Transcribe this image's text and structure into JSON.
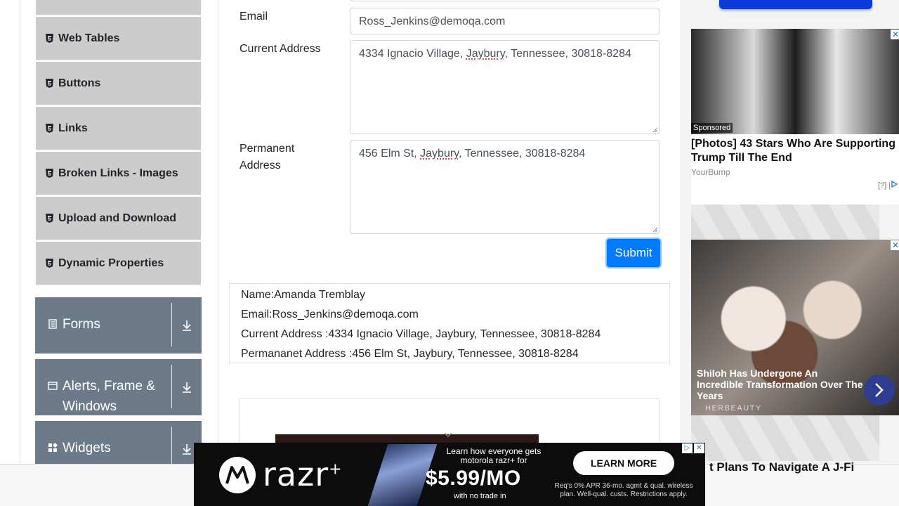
{
  "sidebar": {
    "items": [
      {
        "label": "Web Tables"
      },
      {
        "label": "Buttons"
      },
      {
        "label": "Links"
      },
      {
        "label": "Broken Links - Images"
      },
      {
        "label": "Upload and Download"
      },
      {
        "label": "Dynamic Properties"
      }
    ],
    "groups": [
      {
        "label": "Forms"
      },
      {
        "label": "Alerts, Frame & Windows"
      },
      {
        "label": "Widgets"
      }
    ]
  },
  "form": {
    "email_label": "Email",
    "email_value": "Ross_Jenkins@demoqa.com",
    "current_address_label": "Current Address",
    "current_address_pre": "4334 Ignacio Village, ",
    "current_address_spell": "Jaybury",
    "current_address_post": ", Tennessee, 30818-8284",
    "permanent_address_label_1": "Permanent",
    "permanent_address_label_2": "Address",
    "permanent_address_pre": "456 Elm St, ",
    "permanent_address_spell": "Jaybury",
    "permanent_address_post": ", Tennessee, 30818-8284",
    "submit_label": "Submit"
  },
  "output": {
    "name": "Name:Amanda Tremblay",
    "email": "Email:Ross_Jenkins@demoqa.com",
    "current_address": "Current Address :4334 Ignacio Village, Jaybury, Tennessee, 30818-8284",
    "permanent_address": "Permananet Address :456 Elm St, Jaybury, Tennessee, 30818-8284"
  },
  "ads": {
    "ad1": {
      "tag": "Sponsored",
      "title": "[Photos] 43 Stars Who Are Supporting Trump Till The End",
      "source": "YourBump",
      "choices": "[?]"
    },
    "ad2": {
      "title": "Shiloh Has Undergone An Incredible Transformation Over The Years",
      "source": "HERBEAUTY"
    },
    "bottom_text": "t Plans To Navigate A J-Fi",
    "banner": {
      "brand": "razr",
      "brand_sup": "+",
      "learn": "Learn how everyone gets motorola razr+ for",
      "price": "$5.99/MO",
      "trade": "with no trade in",
      "cta": "LEARN MORE",
      "legal": "Req's 0% APR 36-mo. agmt & qual. wireless plan. Well-qual. custs. Restrictions apply."
    }
  },
  "colors": {
    "sidebar_item_bg": "#cccccc",
    "group_bg": "#6c7a89",
    "submit_bg": "#007bff"
  }
}
